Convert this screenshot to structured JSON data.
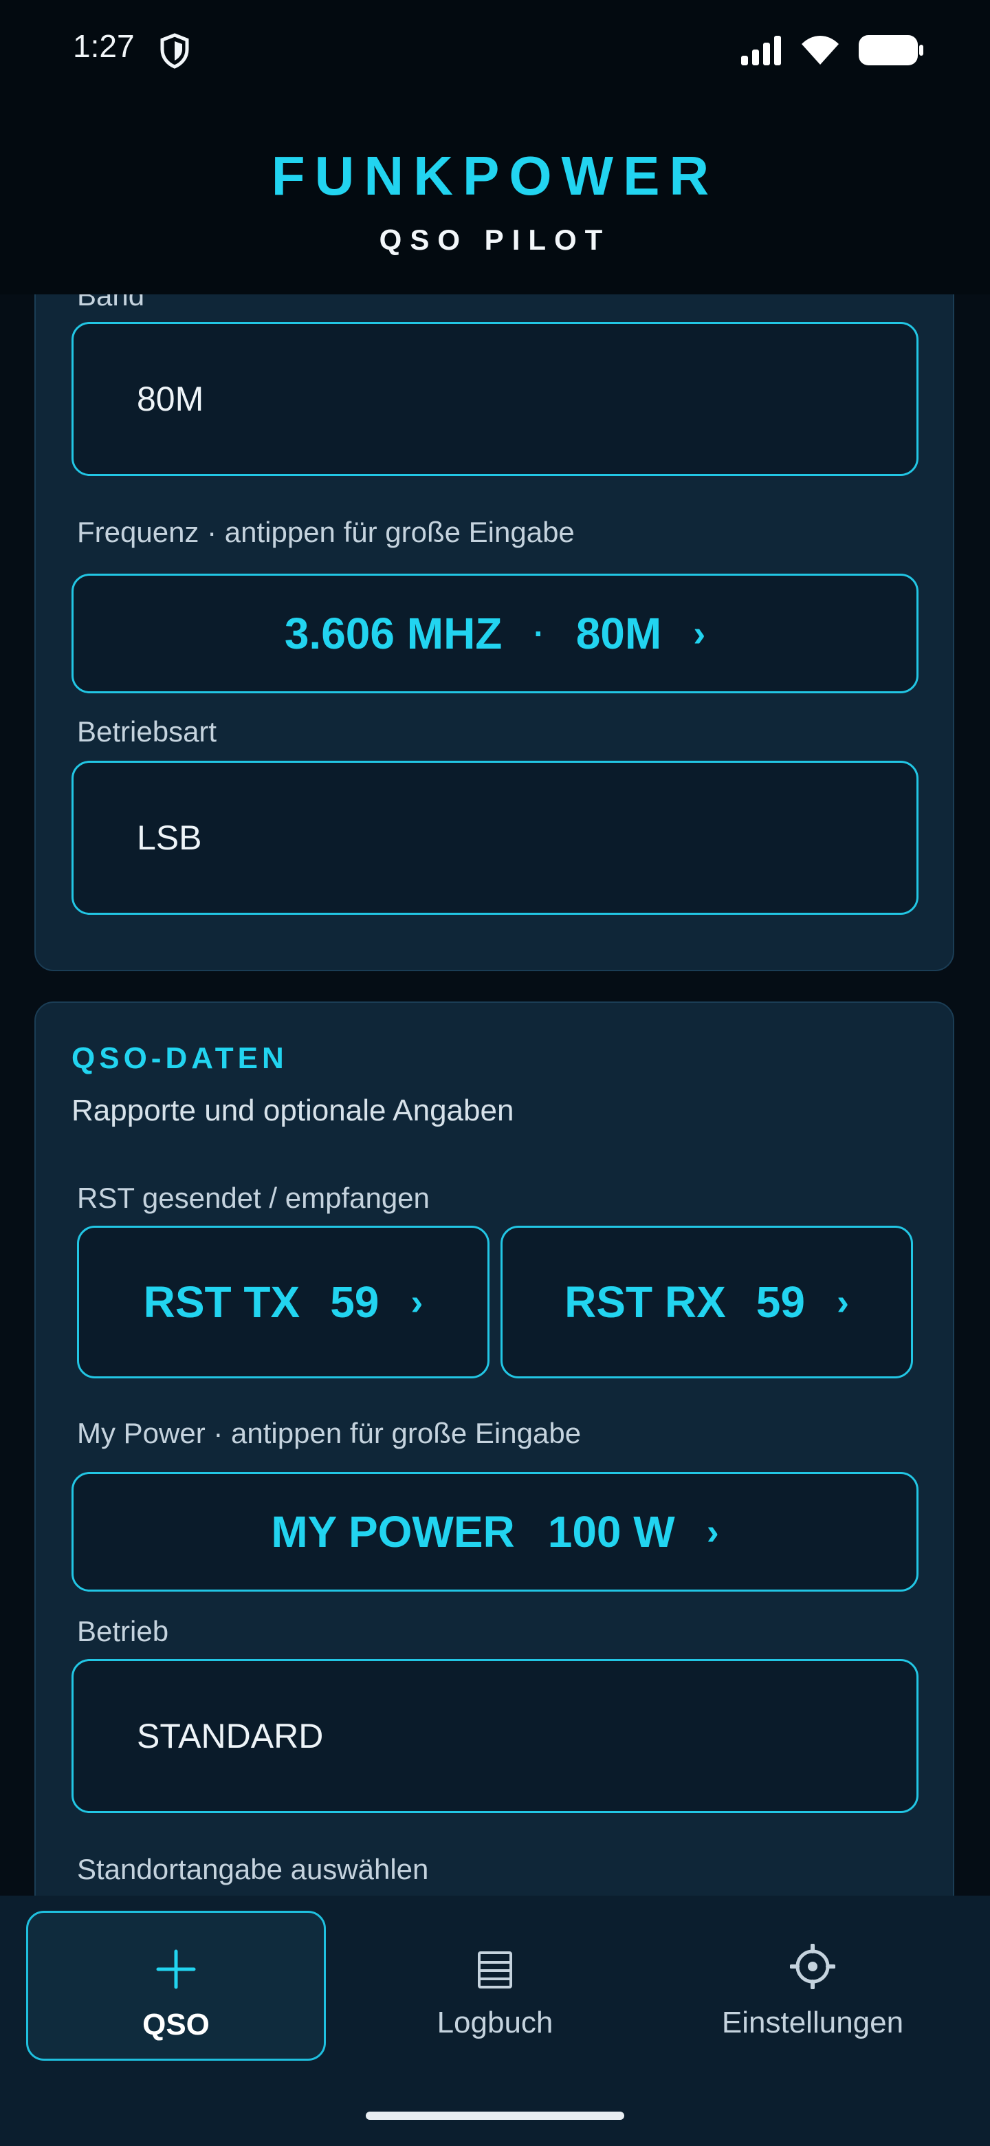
{
  "status_bar": {
    "time": "1:27"
  },
  "header": {
    "title": "FUNKPOWER",
    "subtitle": "QSO PILOT"
  },
  "station_card": {
    "band_label": "Band",
    "band_value": "80M",
    "freq_label": "Frequenz · antippen für große Eingabe",
    "freq_value": "3.606 MHZ",
    "freq_sep": "·",
    "freq_band": "80M",
    "chevron": "›",
    "mode_label": "Betriebsart",
    "mode_value": "LSB"
  },
  "qso_card": {
    "title": "QSO-DATEN",
    "description": "Rapporte und optionale Angaben",
    "rst_label": "RST gesendet / empfangen",
    "rst_tx_label": "RST TX",
    "rst_tx_value": "59",
    "rst_rx_label": "RST RX",
    "rst_rx_value": "59",
    "power_label": "My Power · antippen für große Eingabe",
    "power_button_label": "MY POWER",
    "power_value": "100 W",
    "operation_label": "Betrieb",
    "operation_value": "STANDARD",
    "location_label": "Standortangabe auswählen",
    "chevron": "›"
  },
  "nav": {
    "items": [
      {
        "label": "QSO",
        "icon": "plus-icon",
        "active": true
      },
      {
        "label": "Logbuch",
        "icon": "logbook-icon",
        "active": false
      },
      {
        "label": "Einstellungen",
        "icon": "gear-icon",
        "active": false
      }
    ]
  },
  "colors": {
    "accent": "#22d4f0",
    "background": "#050d15",
    "card": "#0f2638"
  }
}
